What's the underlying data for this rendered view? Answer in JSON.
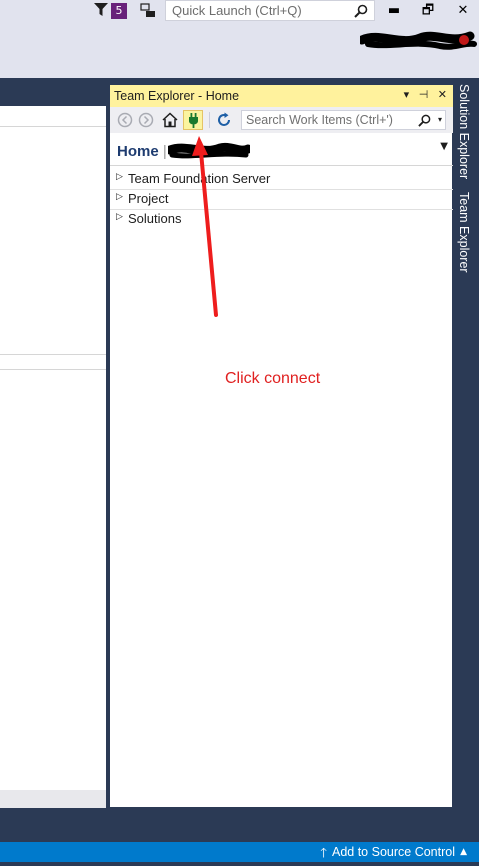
{
  "titlebar": {
    "notification_count": "5",
    "quick_launch_placeholder": "Quick Launch (Ctrl+Q)",
    "minimize": "▬",
    "restore": "🗗",
    "close": "✕"
  },
  "team_explorer": {
    "title": "Team Explorer - Home",
    "header_icons": "▾ ⊣ ✕",
    "search_placeholder": "Search Work Items (Ctrl+')",
    "nav_title": "Home",
    "nav_separator": "|",
    "sections": [
      {
        "label": "Team Foundation Server"
      },
      {
        "label": "Project"
      },
      {
        "label": "Solutions"
      }
    ]
  },
  "side_tabs": [
    "Solution Explorer",
    "Team Explorer"
  ],
  "annotation": {
    "text": "Click connect",
    "color": "#e02020"
  },
  "statusbar": {
    "label": "Add to Source Control"
  },
  "colors": {
    "frame": "#2b3a55",
    "titlebar": "#e1e3ee",
    "panel_header": "#fff29d",
    "statusbar": "#007acc",
    "notification_badge": "#68217a"
  },
  "icons": {
    "funnel": "funnel-icon",
    "feedback": "feedback-icon",
    "search": "search-icon",
    "back": "back-icon",
    "forward": "forward-icon",
    "home": "home-icon",
    "connect": "connect-plug-icon",
    "refresh": "refresh-icon",
    "upload": "up-arrow-icon"
  }
}
